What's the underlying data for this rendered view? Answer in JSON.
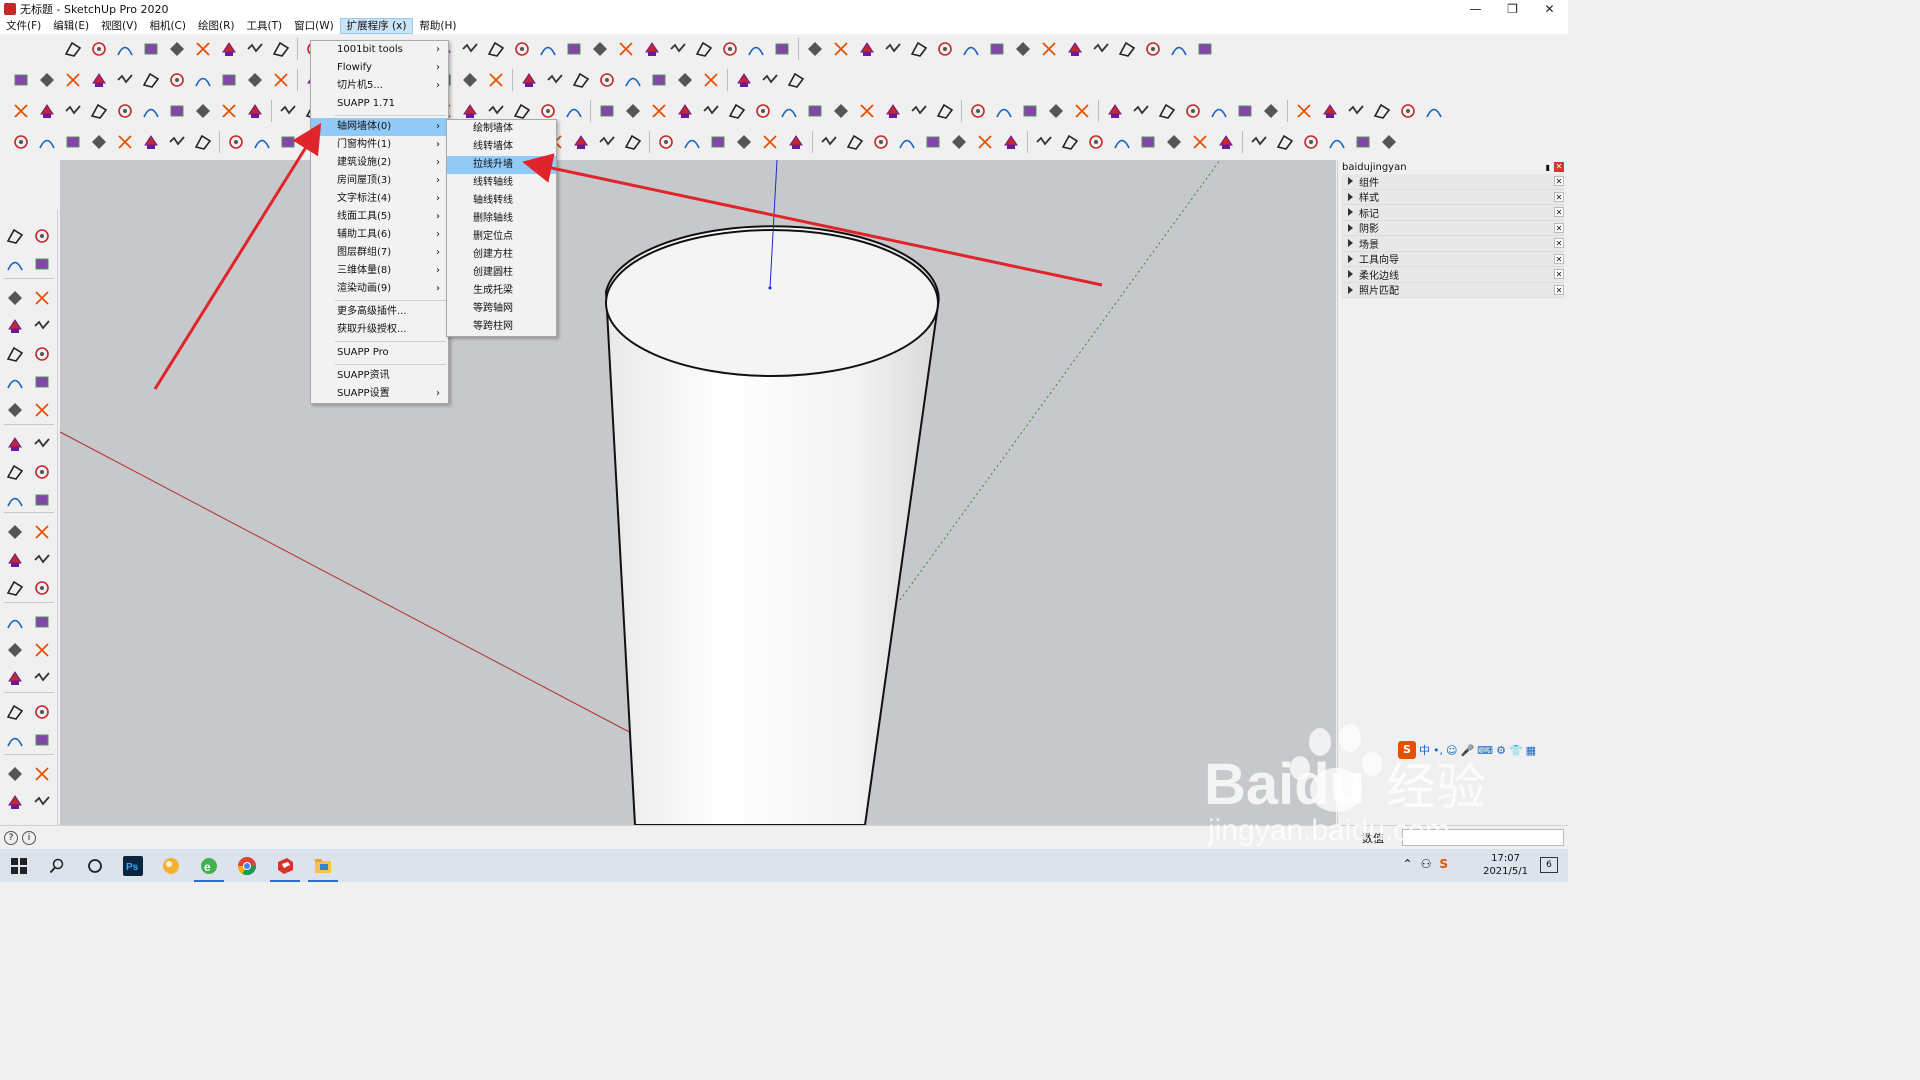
{
  "window": {
    "title": "无标题 - SketchUp Pro 2020",
    "minimize": "—",
    "restore": "❐",
    "close": "✕"
  },
  "menubar": [
    {
      "label": "文件(F)"
    },
    {
      "label": "编辑(E)"
    },
    {
      "label": "视图(V)"
    },
    {
      "label": "相机(C)"
    },
    {
      "label": "绘图(R)"
    },
    {
      "label": "工具(T)"
    },
    {
      "label": "窗口(W)"
    },
    {
      "label": "扩展程序 (x)",
      "active": true
    },
    {
      "label": "帮助(H)"
    }
  ],
  "extensions_menu": {
    "groups": [
      [
        {
          "label": "1001bit tools",
          "submenu": true
        },
        {
          "label": "Flowify",
          "submenu": true
        },
        {
          "label": "切片机5...",
          "submenu": true
        },
        {
          "label": "SUAPP 1.71",
          "submenu": false
        }
      ],
      [
        {
          "label": "轴网墙体(0)",
          "submenu": true,
          "highlighted": true
        },
        {
          "label": "门窗构件(1)",
          "submenu": true
        },
        {
          "label": "建筑设施(2)",
          "submenu": true
        },
        {
          "label": "房间屋顶(3)",
          "submenu": true
        },
        {
          "label": "文字标注(4)",
          "submenu": true
        },
        {
          "label": "线面工具(5)",
          "submenu": true
        },
        {
          "label": "辅助工具(6)",
          "submenu": true
        },
        {
          "label": "图层群组(7)",
          "submenu": true
        },
        {
          "label": "三维体量(8)",
          "submenu": true
        },
        {
          "label": "渲染动画(9)",
          "submenu": true
        }
      ],
      [
        {
          "label": "更多高级插件...",
          "submenu": false
        },
        {
          "label": "获取升级授权...",
          "submenu": false
        }
      ],
      [
        {
          "label": "SUAPP Pro",
          "submenu": false
        }
      ],
      [
        {
          "label": "SUAPP资讯",
          "submenu": false
        },
        {
          "label": "SUAPP设置",
          "submenu": true
        }
      ]
    ]
  },
  "grid_wall_submenu": [
    {
      "label": "绘制墙体"
    },
    {
      "label": "线转墙体"
    },
    {
      "label": "拉线升墙",
      "highlighted": true
    },
    {
      "label": "线转轴线"
    },
    {
      "label": "轴线转线"
    },
    {
      "label": "删除轴线"
    },
    {
      "label": "删定位点"
    },
    {
      "label": "创建方柱"
    },
    {
      "label": "创建圆柱"
    },
    {
      "label": "生成托梁"
    },
    {
      "label": "等跨轴网"
    },
    {
      "label": "等跨柱网"
    }
  ],
  "tray": {
    "title": "baidujingyan",
    "panels": [
      "组件",
      "样式",
      "标记",
      "阴影",
      "场景",
      "工具向导",
      "柔化边线",
      "照片匹配"
    ]
  },
  "statusbar": {
    "measure_label": "数值"
  },
  "taskbar": {
    "time": "17:07",
    "date": "2021/5/1",
    "notification_count": "6"
  },
  "ime": {
    "logo": "S",
    "mode": "中"
  },
  "watermark": {
    "brand": "Baidu",
    "brand_cn": "经验",
    "site": "jingyan.baidu.com"
  },
  "colors": {
    "accent": "#91c9f7",
    "arrow": "#e0242b",
    "viewport_bg": "#c6c8cb",
    "model_face": "#f5f5f5"
  }
}
